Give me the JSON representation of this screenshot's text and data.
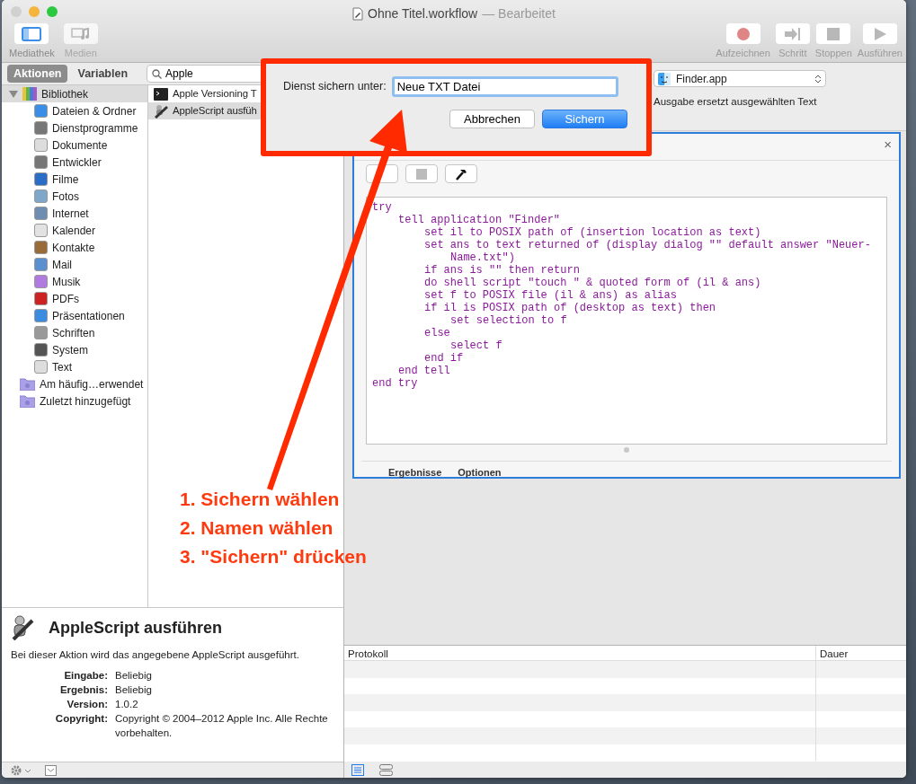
{
  "window": {
    "title": "Ohne Titel.workflow",
    "status": "— Bearbeitet"
  },
  "toolbar_left": [
    {
      "label": "Mediathek",
      "kind": "library",
      "on": true
    },
    {
      "label": "Medien",
      "kind": "media",
      "on": false
    }
  ],
  "toolbar_right": [
    {
      "label": "Aufzeichnen",
      "kind": "record"
    },
    {
      "label": "Schritt",
      "kind": "step"
    },
    {
      "label": "Stoppen",
      "kind": "stop"
    },
    {
      "label": "Ausführen",
      "kind": "run"
    }
  ],
  "library_tabs": [
    {
      "label": "Aktionen",
      "selected": true
    },
    {
      "label": "Variablen",
      "selected": false
    }
  ],
  "search": {
    "value": "Apple"
  },
  "library": [
    {
      "label": "Bibliothek",
      "selected": true,
      "expanded": true,
      "children": [
        {
          "label": "Dateien & Ordner",
          "selected": false
        },
        {
          "label": "Dienstprogramme",
          "selected": false
        },
        {
          "label": "Dokumente",
          "selected": false
        },
        {
          "label": "Entwickler",
          "selected": false
        },
        {
          "label": "Filme",
          "selected": false
        },
        {
          "label": "Fotos",
          "selected": false
        },
        {
          "label": "Internet",
          "selected": false
        },
        {
          "label": "Kalender",
          "selected": false
        },
        {
          "label": "Kontakte",
          "selected": false
        },
        {
          "label": "Mail",
          "selected": false
        },
        {
          "label": "Musik",
          "selected": false
        },
        {
          "label": "PDFs",
          "selected": false
        },
        {
          "label": "Präsentationen",
          "selected": false
        },
        {
          "label": "Schriften",
          "selected": false
        },
        {
          "label": "System",
          "selected": false
        },
        {
          "label": "Text",
          "selected": false
        }
      ]
    },
    {
      "label": "Am häufig…erwendet",
      "selected": false
    },
    {
      "label": "Zuletzt hinzugefügt",
      "selected": false
    }
  ],
  "actions": [
    {
      "label": "Apple Versioning T",
      "kind": "terminal",
      "selected": false
    },
    {
      "label": "AppleScript ausfüh",
      "kind": "script",
      "selected": true
    }
  ],
  "workflow": {
    "application": "Finder.app",
    "output_note": "Ausgabe ersetzt ausgewählten Text",
    "close": "×",
    "code": [
      {
        "text": "try",
        "children": [
          {
            "text": "tell application \"Finder\"",
            "children": [
              {
                "text": "set il to POSIX path of (insertion location as text)"
              },
              {
                "text": "set ans to text returned of (display dialog \"\" default answer \"Neuer-Name.txt\")"
              },
              {
                "text": "if ans is \"\" then return"
              },
              {
                "text": "do shell script \"touch \" & quoted form of (il & ans)"
              },
              {
                "text": "set f to POSIX file (il & ans) as alias"
              },
              {
                "text": "if il is POSIX path of (desktop as text) then",
                "children": [
                  {
                    "text": "set selection to f"
                  }
                ]
              },
              {
                "text": "else",
                "children": [
                  {
                    "text": "select f"
                  }
                ]
              },
              {
                "text": "end if"
              }
            ]
          },
          {
            "text": "end tell"
          }
        ]
      },
      {
        "text": "end try"
      }
    ],
    "tabs": [
      "Ergebnisse",
      "Optionen"
    ]
  },
  "description": {
    "title": "AppleScript ausführen",
    "text": "Bei dieser Aktion wird das angegebene AppleScript ausgeführt.",
    "details": [
      {
        "label": "Eingabe:",
        "value": "Beliebig"
      },
      {
        "label": "Ergebnis:",
        "value": "Beliebig"
      },
      {
        "label": "Version:",
        "value": "1.0.2"
      },
      {
        "label": "Copyright:",
        "value": "Copyright © 2004–2012 Apple Inc. Alle Rechte vorbehalten."
      }
    ]
  },
  "log": {
    "columns": [
      "Protokoll",
      "Dauer"
    ]
  },
  "view_buttons": [
    {
      "kind": "list",
      "selected": true
    },
    {
      "kind": "split",
      "selected": false
    }
  ],
  "dialog": {
    "label": "Dienst sichern unter:",
    "value": "Neue TXT Datei",
    "buttons": [
      {
        "label": "Abbrechen",
        "kind": "cancel"
      },
      {
        "label": "Sichern",
        "kind": "default"
      }
    ]
  },
  "annotation": {
    "steps": [
      "1. Sichern wählen",
      "2. Namen wählen",
      "3. \"Sichern\" drücken"
    ]
  }
}
